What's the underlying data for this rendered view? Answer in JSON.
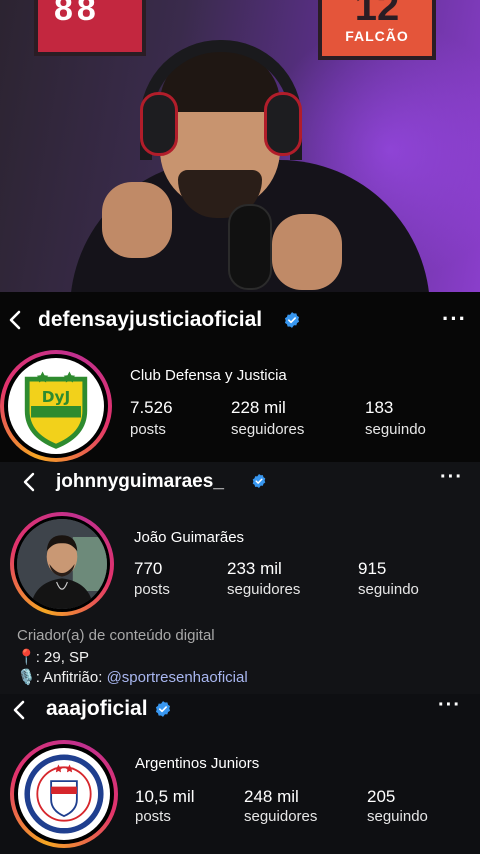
{
  "video": {
    "frame_right_number": "12",
    "frame_right_name": "FALCÃO",
    "frame_left_number": "88"
  },
  "profiles": [
    {
      "username": "defensayjusticiaoficial",
      "full_name": "Club Defensa y Justicia",
      "logo_text": "DyJ",
      "stats": [
        {
          "value": "7.526",
          "label": "posts"
        },
        {
          "value": "228 mil",
          "label": "seguidores"
        },
        {
          "value": "183",
          "label": "seguindo"
        }
      ]
    },
    {
      "username": "johnnyguimaraes_",
      "full_name": "João Guimarães",
      "stats": [
        {
          "value": "770",
          "label": "posts"
        },
        {
          "value": "233 mil",
          "label": "seguidores"
        },
        {
          "value": "915",
          "label": "seguindo"
        }
      ],
      "bio": {
        "category": "Criador(a) de conteúdo digital",
        "location_icon": "📍",
        "location": ": 29, SP",
        "mic_icon": "🎙️",
        "host_prefix": ": Anfitrião: ",
        "host_link": "@sportresenhaoficial"
      }
    },
    {
      "username": "aaajoficial",
      "full_name": "Argentinos Juniors",
      "stats": [
        {
          "value": "10,5 mil",
          "label": "posts"
        },
        {
          "value": "248 mil",
          "label": "seguidores"
        },
        {
          "value": "205",
          "label": "seguindo"
        }
      ]
    }
  ],
  "icons": {
    "back": "chevron-left-icon",
    "verified": "verified-badge-icon",
    "more": "more-options-icon"
  },
  "colors": {
    "verified": "#3897f0",
    "ring_start": "#f5a623",
    "ring_mid": "#e2336b",
    "link": "#a9b7f0",
    "dyj_yellow": "#f2d11b",
    "dyj_green": "#2e8b2f",
    "argentinos_red": "#d6262c"
  }
}
